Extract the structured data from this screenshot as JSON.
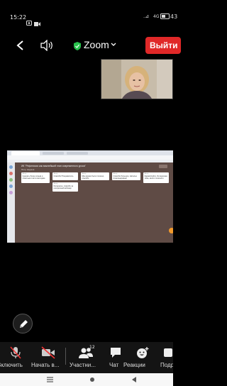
{
  "status_bar": {
    "time": "15:22",
    "signal_text": "4G",
    "battery": "43"
  },
  "header": {
    "title": "Zoom",
    "leave_label": "Выйти"
  },
  "shared_screen": {
    "board_title": "ИК \"Рефлексия как важнейший этап современного урока\"",
    "board_subtitle": "Пётр Наумов",
    "cards": [
      {
        "author": "Автор",
        "text": "Сделать более ясным и понятным этап в методике"
      },
      {
        "author": "Автор",
        "text": "Спасибо! Понравилось"
      },
      {
        "author": "Автор",
        "text": "Мне время было полезно, спасибо"
      },
      {
        "author": "Автор",
        "text": "Спасибо большое, Наталья Александровна!"
      },
      {
        "author": "Автор",
        "text": "Здравствуйте. Интересная тема, много полезного"
      },
      {
        "author": "Автор",
        "text": "Интересно, спасибо за интересный вебинар"
      }
    ]
  },
  "toolbar": {
    "items": [
      {
        "label": "Включить",
        "icon": "mic-off-icon"
      },
      {
        "label": "Начать в...",
        "icon": "video-off-icon"
      },
      {
        "label": "Участни...",
        "icon": "participants-icon",
        "badge": "12"
      },
      {
        "label": "Чат",
        "icon": "chat-icon"
      },
      {
        "label": "Реакции",
        "icon": "reactions-icon"
      },
      {
        "label": "Подр",
        "icon": "more-icon"
      }
    ]
  }
}
